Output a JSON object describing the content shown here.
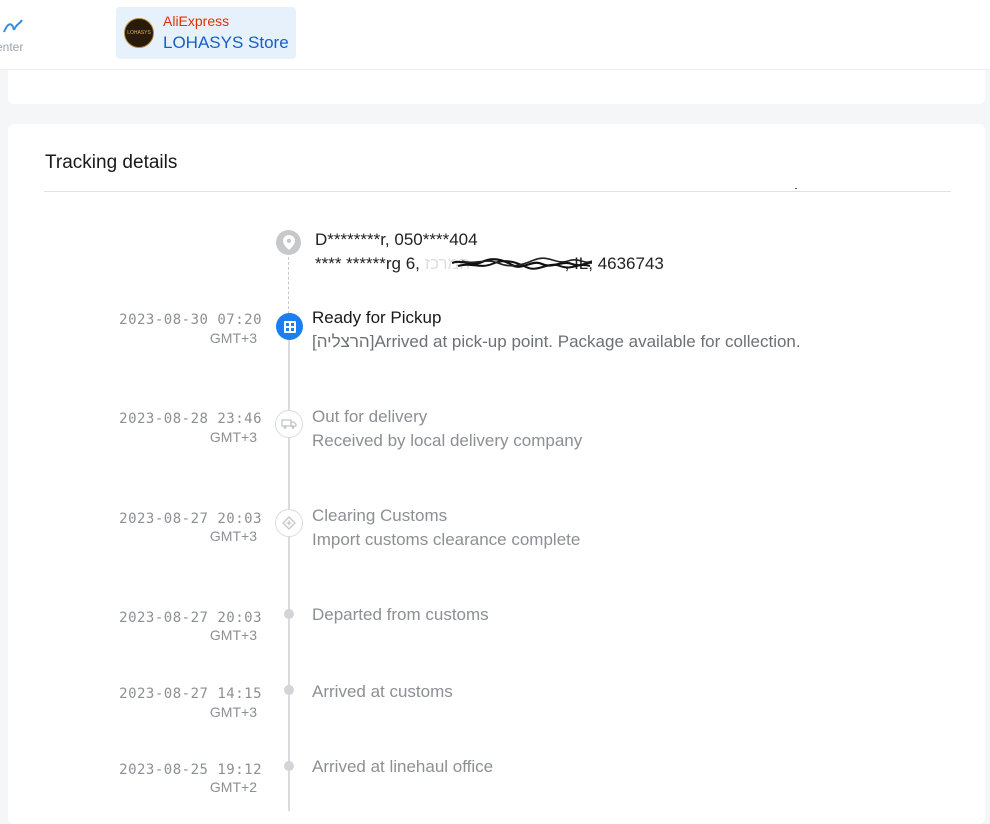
{
  "header": {
    "partial_logo_text": "enter",
    "store": {
      "avatar_text": "LOHASYS",
      "brand": "AliExpress",
      "name": "LOHASYS Store"
    }
  },
  "tracking": {
    "title": "Tracking details",
    "address": {
      "line1": "D********r,  050****404",
      "line2_before": "**** ******rg 6, ",
      "line2_hebrew": "המרכז",
      "line2_after": ",  IL,  4636743"
    },
    "events": [
      {
        "date": "2023-08-30 07:20",
        "tz": "GMT+3",
        "title": "Ready for Pickup",
        "desc": "[הרצליה]Arrived at pick-up point. Package available for collection.",
        "icon": "building-icon",
        "state": "active"
      },
      {
        "date": "2023-08-28 23:46",
        "tz": "GMT+3",
        "title": "Out for delivery",
        "desc": "Received by local delivery company",
        "icon": "truck-icon",
        "state": "milestone"
      },
      {
        "date": "2023-08-27 20:03",
        "tz": "GMT+3",
        "title": "Clearing Customs",
        "desc": "Import customs clearance complete",
        "icon": "customs-icon",
        "state": "milestone"
      },
      {
        "date": "2023-08-27 20:03",
        "tz": "GMT+3",
        "title": "Departed from customs",
        "state": "dot"
      },
      {
        "date": "2023-08-27 14:15",
        "tz": "GMT+3",
        "title": "Arrived at customs",
        "state": "dot"
      },
      {
        "date": "2023-08-25 19:12",
        "tz": "GMT+2",
        "title": "Arrived at linehaul office",
        "state": "dot"
      }
    ]
  },
  "colors": {
    "accent": "#1b7ff0",
    "brand_red": "#e62e04",
    "store_link": "#1560c4",
    "muted": "#8c8f94"
  }
}
